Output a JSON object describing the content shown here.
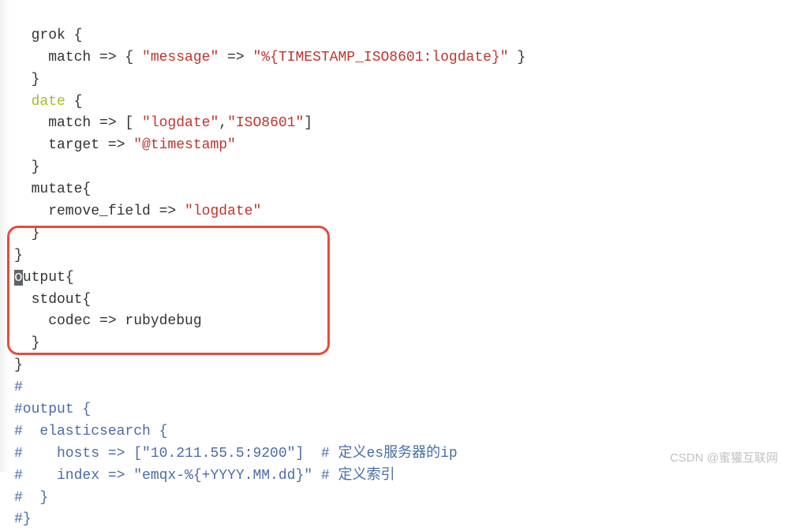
{
  "code": {
    "l1_a": "  grok {",
    "l2_a": "    match => { ",
    "l2_b": "\"message\"",
    "l2_c": " => ",
    "l2_d": "\"%{TIMESTAMP_ISO8601:logdate}\"",
    "l2_e": " }",
    "l3_a": "  }",
    "l4_a": "  ",
    "l4_b": "date",
    "l4_c": " {",
    "l5_a": "    match => [ ",
    "l5_b": "\"logdate\"",
    "l5_c": ",",
    "l5_d": "\"ISO8601\"",
    "l5_e": "]",
    "l6_a": "    target => ",
    "l6_b": "\"@timestamp\"",
    "l7_a": "  }",
    "l8_a": "  mutate{",
    "l9_a": "    remove_field => ",
    "l9_b": "\"logdate\"",
    "l10_a": "  }",
    "l11_a": "}",
    "l12_a": "o",
    "l12_b": "utput{",
    "l13_a": "  stdout{",
    "l14_a": "    codec => rubydebug",
    "l15_a": "  }",
    "l16_a": "}",
    "l17_a": "#",
    "l18_a": "#output {",
    "l19_a": "#  elasticsearch {",
    "l20_a": "#    hosts => [\"10.211.55.5:9200\"]  # 定义es服务器的ip",
    "l21_a": "#    index => \"emqx-%{+YYYY.MM.dd}\" # 定义索引",
    "l22_a": "#  }",
    "l23_a": "#}"
  },
  "watermark": "CSDN @蜜獾互联网"
}
